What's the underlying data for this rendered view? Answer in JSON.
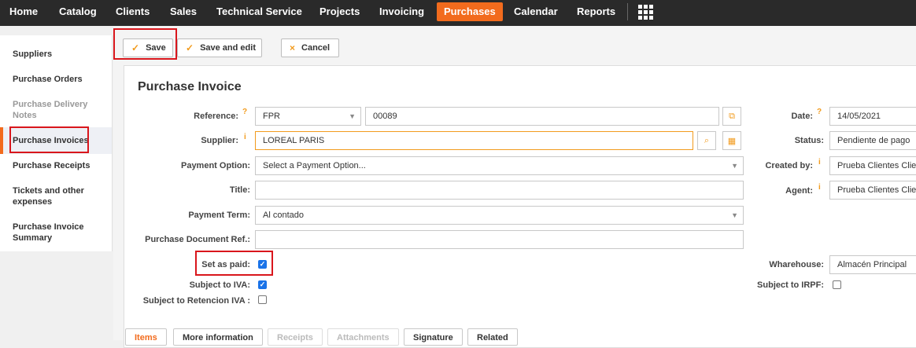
{
  "nav": {
    "items": [
      "Home",
      "Catalog",
      "Clients",
      "Sales",
      "Technical Service",
      "Projects",
      "Invoicing",
      "Purchases",
      "Calendar",
      "Reports"
    ],
    "active": "Purchases",
    "apps_icon": "grid-icon"
  },
  "sidebar": {
    "items": [
      "Suppliers",
      "Purchase Orders",
      "Purchase Delivery Notes",
      "Purchase Invoices",
      "Purchase Receipts",
      "Tickets and other expenses",
      "Purchase Invoice Summary"
    ],
    "active": "Purchase Invoices"
  },
  "toolbar": {
    "save": "Save",
    "save_edit": "Save and edit",
    "cancel": "Cancel"
  },
  "form": {
    "title": "Purchase Invoice",
    "reference_label": "Reference:",
    "reference_series": "FPR",
    "reference_number": "00089",
    "supplier_label": "Supplier:",
    "supplier_value": "LOREAL PARIS",
    "payment_option_label": "Payment Option:",
    "payment_option_value": "Select a Payment Option...",
    "title_label": "Title:",
    "title_value": "",
    "payment_term_label": "Payment Term:",
    "payment_term_value": "Al contado",
    "purchase_doc_ref_label": "Purchase Document Ref.:",
    "purchase_doc_ref_value": "",
    "set_as_paid_label": "Set as paid:",
    "set_as_paid": true,
    "subject_iva_label": "Subject to IVA:",
    "subject_iva": true,
    "subject_ret_iva_label": "Subject to Retencion IVA :",
    "subject_ret_iva": false,
    "date_label": "Date:",
    "date_value": "14/05/2021",
    "status_label": "Status:",
    "status_value": "Pendiente de pago",
    "created_by_label": "Created by:",
    "created_by_value": "Prueba Clientes Clie",
    "agent_label": "Agent:",
    "agent_value": "Prueba Clientes Clie",
    "warehouse_label": "Wharehouse:",
    "warehouse_value": "Almacén Principal",
    "subject_irpf_label": "Subject to IRPF:",
    "subject_irpf": false,
    "hint_question": "?",
    "hint_info": "i"
  },
  "tabs": [
    "Items",
    "More information",
    "Receipts",
    "Attachments",
    "Signature",
    "Related"
  ],
  "colors": {
    "accent": "#f26b1d",
    "nav_bg": "#2a2a2a",
    "highlight_box": "#d9161c"
  }
}
